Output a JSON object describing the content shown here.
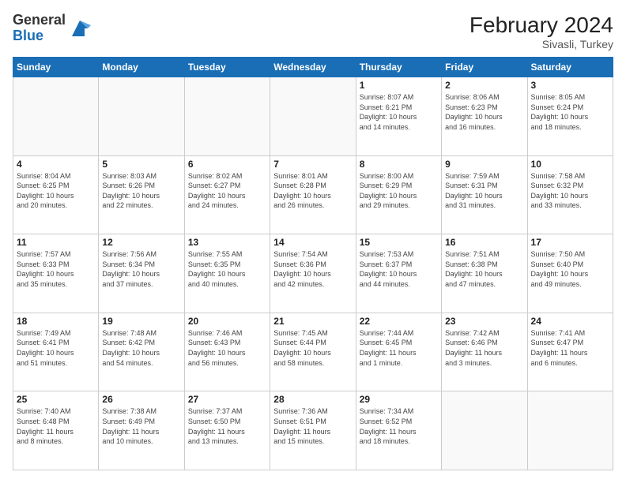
{
  "header": {
    "logo_general": "General",
    "logo_blue": "Blue",
    "month_year": "February 2024",
    "location": "Sivasli, Turkey"
  },
  "weekdays": [
    "Sunday",
    "Monday",
    "Tuesday",
    "Wednesday",
    "Thursday",
    "Friday",
    "Saturday"
  ],
  "weeks": [
    [
      {
        "day": "",
        "info": ""
      },
      {
        "day": "",
        "info": ""
      },
      {
        "day": "",
        "info": ""
      },
      {
        "day": "",
        "info": ""
      },
      {
        "day": "1",
        "info": "Sunrise: 8:07 AM\nSunset: 6:21 PM\nDaylight: 10 hours\nand 14 minutes."
      },
      {
        "day": "2",
        "info": "Sunrise: 8:06 AM\nSunset: 6:23 PM\nDaylight: 10 hours\nand 16 minutes."
      },
      {
        "day": "3",
        "info": "Sunrise: 8:05 AM\nSunset: 6:24 PM\nDaylight: 10 hours\nand 18 minutes."
      }
    ],
    [
      {
        "day": "4",
        "info": "Sunrise: 8:04 AM\nSunset: 6:25 PM\nDaylight: 10 hours\nand 20 minutes."
      },
      {
        "day": "5",
        "info": "Sunrise: 8:03 AM\nSunset: 6:26 PM\nDaylight: 10 hours\nand 22 minutes."
      },
      {
        "day": "6",
        "info": "Sunrise: 8:02 AM\nSunset: 6:27 PM\nDaylight: 10 hours\nand 24 minutes."
      },
      {
        "day": "7",
        "info": "Sunrise: 8:01 AM\nSunset: 6:28 PM\nDaylight: 10 hours\nand 26 minutes."
      },
      {
        "day": "8",
        "info": "Sunrise: 8:00 AM\nSunset: 6:29 PM\nDaylight: 10 hours\nand 29 minutes."
      },
      {
        "day": "9",
        "info": "Sunrise: 7:59 AM\nSunset: 6:31 PM\nDaylight: 10 hours\nand 31 minutes."
      },
      {
        "day": "10",
        "info": "Sunrise: 7:58 AM\nSunset: 6:32 PM\nDaylight: 10 hours\nand 33 minutes."
      }
    ],
    [
      {
        "day": "11",
        "info": "Sunrise: 7:57 AM\nSunset: 6:33 PM\nDaylight: 10 hours\nand 35 minutes."
      },
      {
        "day": "12",
        "info": "Sunrise: 7:56 AM\nSunset: 6:34 PM\nDaylight: 10 hours\nand 37 minutes."
      },
      {
        "day": "13",
        "info": "Sunrise: 7:55 AM\nSunset: 6:35 PM\nDaylight: 10 hours\nand 40 minutes."
      },
      {
        "day": "14",
        "info": "Sunrise: 7:54 AM\nSunset: 6:36 PM\nDaylight: 10 hours\nand 42 minutes."
      },
      {
        "day": "15",
        "info": "Sunrise: 7:53 AM\nSunset: 6:37 PM\nDaylight: 10 hours\nand 44 minutes."
      },
      {
        "day": "16",
        "info": "Sunrise: 7:51 AM\nSunset: 6:38 PM\nDaylight: 10 hours\nand 47 minutes."
      },
      {
        "day": "17",
        "info": "Sunrise: 7:50 AM\nSunset: 6:40 PM\nDaylight: 10 hours\nand 49 minutes."
      }
    ],
    [
      {
        "day": "18",
        "info": "Sunrise: 7:49 AM\nSunset: 6:41 PM\nDaylight: 10 hours\nand 51 minutes."
      },
      {
        "day": "19",
        "info": "Sunrise: 7:48 AM\nSunset: 6:42 PM\nDaylight: 10 hours\nand 54 minutes."
      },
      {
        "day": "20",
        "info": "Sunrise: 7:46 AM\nSunset: 6:43 PM\nDaylight: 10 hours\nand 56 minutes."
      },
      {
        "day": "21",
        "info": "Sunrise: 7:45 AM\nSunset: 6:44 PM\nDaylight: 10 hours\nand 58 minutes."
      },
      {
        "day": "22",
        "info": "Sunrise: 7:44 AM\nSunset: 6:45 PM\nDaylight: 11 hours\nand 1 minute."
      },
      {
        "day": "23",
        "info": "Sunrise: 7:42 AM\nSunset: 6:46 PM\nDaylight: 11 hours\nand 3 minutes."
      },
      {
        "day": "24",
        "info": "Sunrise: 7:41 AM\nSunset: 6:47 PM\nDaylight: 11 hours\nand 6 minutes."
      }
    ],
    [
      {
        "day": "25",
        "info": "Sunrise: 7:40 AM\nSunset: 6:48 PM\nDaylight: 11 hours\nand 8 minutes."
      },
      {
        "day": "26",
        "info": "Sunrise: 7:38 AM\nSunset: 6:49 PM\nDaylight: 11 hours\nand 10 minutes."
      },
      {
        "day": "27",
        "info": "Sunrise: 7:37 AM\nSunset: 6:50 PM\nDaylight: 11 hours\nand 13 minutes."
      },
      {
        "day": "28",
        "info": "Sunrise: 7:36 AM\nSunset: 6:51 PM\nDaylight: 11 hours\nand 15 minutes."
      },
      {
        "day": "29",
        "info": "Sunrise: 7:34 AM\nSunset: 6:52 PM\nDaylight: 11 hours\nand 18 minutes."
      },
      {
        "day": "",
        "info": ""
      },
      {
        "day": "",
        "info": ""
      }
    ]
  ]
}
